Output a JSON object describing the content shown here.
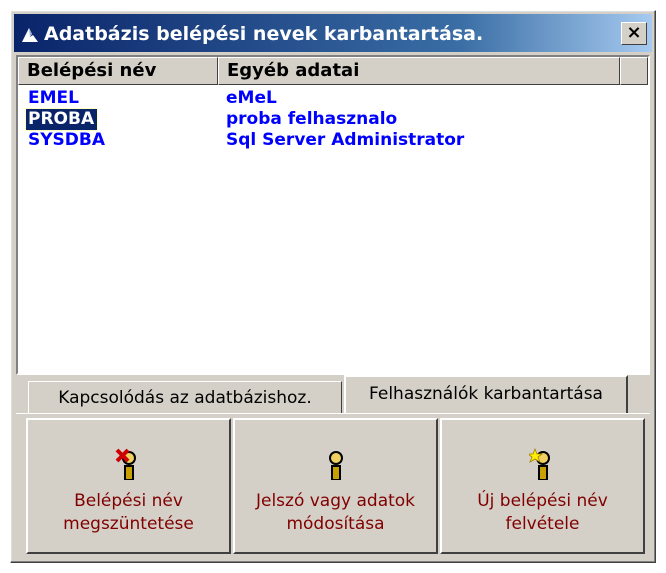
{
  "window": {
    "title": "Adatbázis belépési nevek karbantartása.",
    "close_label": "×"
  },
  "list": {
    "columns": [
      "Belépési név",
      "Egyéb adatai"
    ],
    "rows": [
      {
        "name": "EMEL",
        "info": "eMeL",
        "selected": false
      },
      {
        "name": "PROBA",
        "info": "proba felhasznalo",
        "selected": true
      },
      {
        "name": "SYSDBA",
        "info": "Sql Server Administrator",
        "selected": false
      }
    ]
  },
  "tabs": [
    {
      "label": "Kapcsolódás az adatbázishoz.",
      "active": false
    },
    {
      "label": "Felhasználók karbantartása",
      "active": true
    }
  ],
  "buttons": {
    "delete": {
      "label": "Belépési név\nmegszüntetése",
      "icon": "user-delete-icon"
    },
    "modify": {
      "label": "Jelszó vagy adatok\nmódosítása",
      "icon": "user-icon"
    },
    "add": {
      "label": "Új belépési név\nfelvétele",
      "icon": "user-add-icon"
    }
  },
  "colors": {
    "title_bar": "#0a246a",
    "list_text": "#0000ff",
    "button_text": "#800000",
    "face": "#d4d0c8"
  }
}
